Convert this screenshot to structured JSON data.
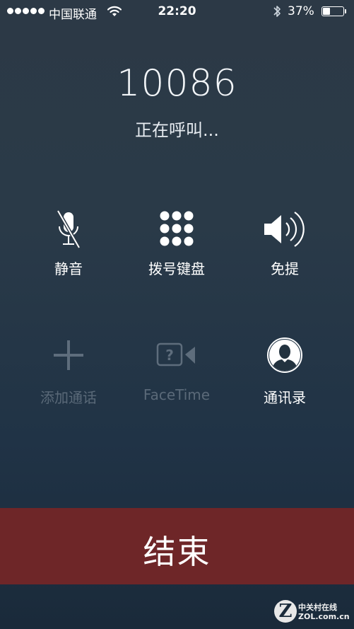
{
  "status_bar": {
    "carrier": "中国联通",
    "time": "22:20",
    "battery_text": "37%",
    "battery_level": 0.37
  },
  "call": {
    "number": "10086",
    "status": "正在呼叫..."
  },
  "controls": [
    {
      "label": "静音",
      "icon": "mic-muted-icon",
      "enabled": true
    },
    {
      "label": "拨号键盘",
      "icon": "keypad-icon",
      "enabled": true
    },
    {
      "label": "免提",
      "icon": "speaker-icon",
      "enabled": true
    },
    {
      "label": "添加通话",
      "icon": "plus-icon",
      "enabled": false
    },
    {
      "label": "FaceTime",
      "icon": "facetime-icon",
      "enabled": false
    },
    {
      "label": "通讯录",
      "icon": "contacts-icon",
      "enabled": true
    }
  ],
  "end_call": {
    "label": "结束",
    "color": "#6e2628"
  },
  "watermark": {
    "letter": "Z",
    "cn": "中关村在线",
    "en": "ZOL.com.cn"
  }
}
